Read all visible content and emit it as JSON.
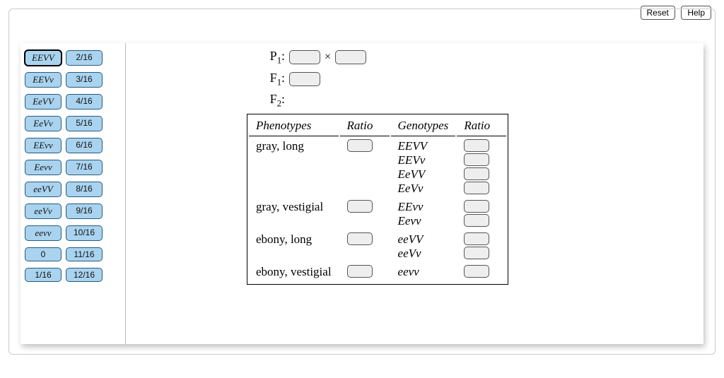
{
  "toolbar": {
    "reset": "Reset",
    "help": "Help"
  },
  "tiles": {
    "left": [
      "EEVV",
      "EEVv",
      "EeVV",
      "EeVv",
      "EEvv",
      "Eevv",
      "eeVV",
      "eeVv",
      "eevv",
      "0",
      "1/16"
    ],
    "right": [
      "2/16",
      "3/16",
      "4/16",
      "5/16",
      "6/16",
      "7/16",
      "8/16",
      "9/16",
      "10/16",
      "11/16",
      "12/16"
    ],
    "selected_left_index": 0
  },
  "labels": {
    "P1": "P",
    "P1_sub": "1",
    "F1": "F",
    "F1_sub": "1",
    "F2": "F",
    "F2_sub": "2",
    "cross": "×",
    "colon": ":"
  },
  "table": {
    "headers": [
      "Phenotypes",
      "Ratio",
      "Genotypes",
      "Ratio"
    ],
    "rows": [
      {
        "phenotype": "gray, long",
        "genotypes": [
          "EEVV",
          "EEVv",
          "EeVV",
          "EeVv"
        ]
      },
      {
        "phenotype": "gray, vestigial",
        "genotypes": [
          "EEvv",
          "Eevv"
        ]
      },
      {
        "phenotype": "ebony, long",
        "genotypes": [
          "eeVV",
          "eeVv"
        ]
      },
      {
        "phenotype": "ebony, vestigial",
        "genotypes": [
          "eevv"
        ]
      }
    ]
  }
}
